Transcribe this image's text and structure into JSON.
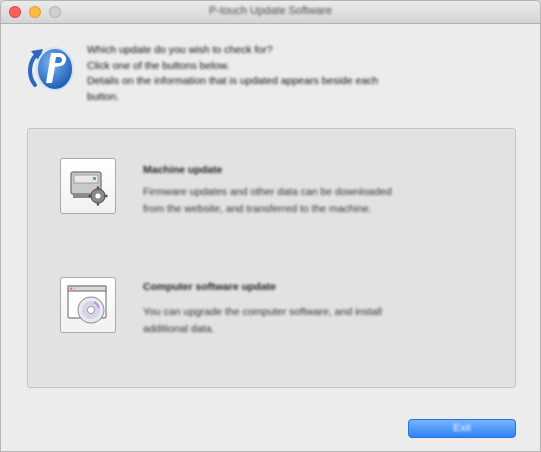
{
  "window": {
    "title": "P-touch Update Software"
  },
  "intro": {
    "line1": "Which update do you wish to check for?",
    "line2": "Click one of the buttons below.",
    "line3": "Details on the information that is updated appears beside each",
    "line4": "button."
  },
  "options": [
    {
      "title": "Machine update",
      "desc1": "Firmware updates and other data can be downloaded",
      "desc2": "from the website, and transferred to the machine.",
      "icon": "printer-gear-icon"
    },
    {
      "title": "Computer software update",
      "desc1": "You can upgrade the computer software, and install",
      "desc2": "additional data.",
      "icon": "software-cd-icon"
    }
  ],
  "footer": {
    "exit_label": "Exit"
  },
  "colors": {
    "primary_button": "#3f8ef7",
    "app_icon_blue": "#2f6fc8"
  }
}
